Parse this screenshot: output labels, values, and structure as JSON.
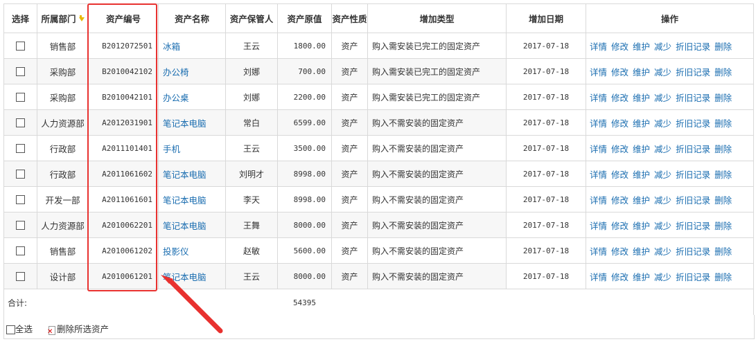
{
  "columns": {
    "select": "选择",
    "dept": "所属部门",
    "code": "资产编号",
    "name": "资产名称",
    "keeper": "资产保管人",
    "value": "资产原值",
    "nature": "资产性质",
    "add_type": "增加类型",
    "add_date": "增加日期",
    "ops": "操作"
  },
  "ops_labels": {
    "detail": "详情",
    "edit": "修改",
    "maintain": "维护",
    "reduce": "减少",
    "depreciation": "折旧记录",
    "delete": "删除"
  },
  "rows": [
    {
      "dept": "销售部",
      "code": "B2012072501",
      "name": "冰箱",
      "keeper": "王云",
      "value": "1800.00",
      "nature": "资产",
      "add_type": "购入需安装已完工的固定资产",
      "add_date": "2017-07-18"
    },
    {
      "dept": "采购部",
      "code": "B2010042102",
      "name": "办公椅",
      "keeper": "刘娜",
      "value": "700.00",
      "nature": "资产",
      "add_type": "购入需安装已完工的固定资产",
      "add_date": "2017-07-18"
    },
    {
      "dept": "采购部",
      "code": "B2010042101",
      "name": "办公桌",
      "keeper": "刘娜",
      "value": "2200.00",
      "nature": "资产",
      "add_type": "购入需安装已完工的固定资产",
      "add_date": "2017-07-18"
    },
    {
      "dept": "人力资源部",
      "code": "A2012031901",
      "name": "笔记本电脑",
      "keeper": "常白",
      "value": "6599.00",
      "nature": "资产",
      "add_type": "购入不需安装的固定资产",
      "add_date": "2017-07-18"
    },
    {
      "dept": "行政部",
      "code": "A2011101401",
      "name": "手机",
      "keeper": "王云",
      "value": "3500.00",
      "nature": "资产",
      "add_type": "购入不需安装的固定资产",
      "add_date": "2017-07-18"
    },
    {
      "dept": "行政部",
      "code": "A2011061602",
      "name": "笔记本电脑",
      "keeper": "刘明才",
      "value": "8998.00",
      "nature": "资产",
      "add_type": "购入不需安装的固定资产",
      "add_date": "2017-07-18"
    },
    {
      "dept": "开发一部",
      "code": "A2011061601",
      "name": "笔记本电脑",
      "keeper": "李天",
      "value": "8998.00",
      "nature": "资产",
      "add_type": "购入不需安装的固定资产",
      "add_date": "2017-07-18"
    },
    {
      "dept": "人力资源部",
      "code": "A2010062201",
      "name": "笔记本电脑",
      "keeper": "王舞",
      "value": "8000.00",
      "nature": "资产",
      "add_type": "购入不需安装的固定资产",
      "add_date": "2017-07-18"
    },
    {
      "dept": "销售部",
      "code": "A2010061202",
      "name": "投影仪",
      "keeper": "赵敏",
      "value": "5600.00",
      "nature": "资产",
      "add_type": "购入不需安装的固定资产",
      "add_date": "2017-07-18"
    },
    {
      "dept": "设计部",
      "code": "A2010061201",
      "name": "笔记本电脑",
      "keeper": "王云",
      "value": "8000.00",
      "nature": "资产",
      "add_type": "购入不需安装的固定资产",
      "add_date": "2017-07-18"
    }
  ],
  "total": {
    "label": "合计:",
    "value": "54395"
  },
  "footer": {
    "select_all": "全选",
    "delete_selected": "删除所选资产"
  },
  "icons": {
    "sort": "sort-down-arrow-icon",
    "delete": "delete-page-icon"
  },
  "colors": {
    "link": "#1a6db0",
    "highlight": "#e8312f",
    "sort_arrow": "#e8b800"
  }
}
